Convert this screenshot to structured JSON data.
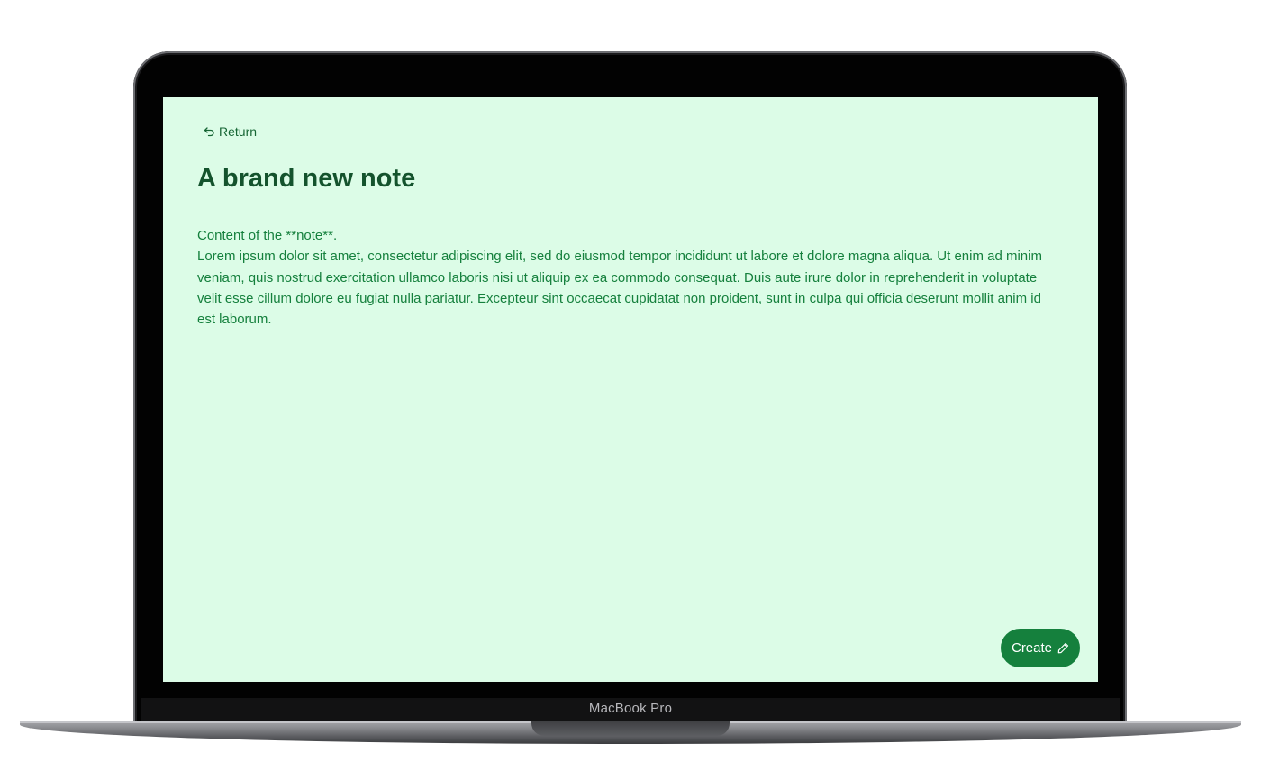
{
  "device": {
    "label": "MacBook Pro"
  },
  "note_editor": {
    "return_label": "Return",
    "title": "A brand new note",
    "content_first_line": "Content of the **note**.",
    "content_body": "Lorem ipsum dolor sit amet, consectetur adipiscing elit, sed do eiusmod tempor incididunt ut labore et dolore magna aliqua. Ut enim ad minim veniam, quis nostrud exercitation ullamco laboris nisi ut aliquip ex ea commodo consequat. Duis aute irure dolor in reprehenderit in voluptate velit esse cillum dolore eu fugiat nulla pariatur. Excepteur sint occaecat cupidatat non proident, sunt in culpa qui officia deserunt mollit anim id est laborum.",
    "create_label": "Create"
  },
  "icons": {
    "return": "return-arrow-icon",
    "create": "pencil-icon"
  },
  "colors": {
    "screen_background": "#dcfce7",
    "title": "#14532d",
    "body_text": "#15803d",
    "button": "#15803d"
  }
}
